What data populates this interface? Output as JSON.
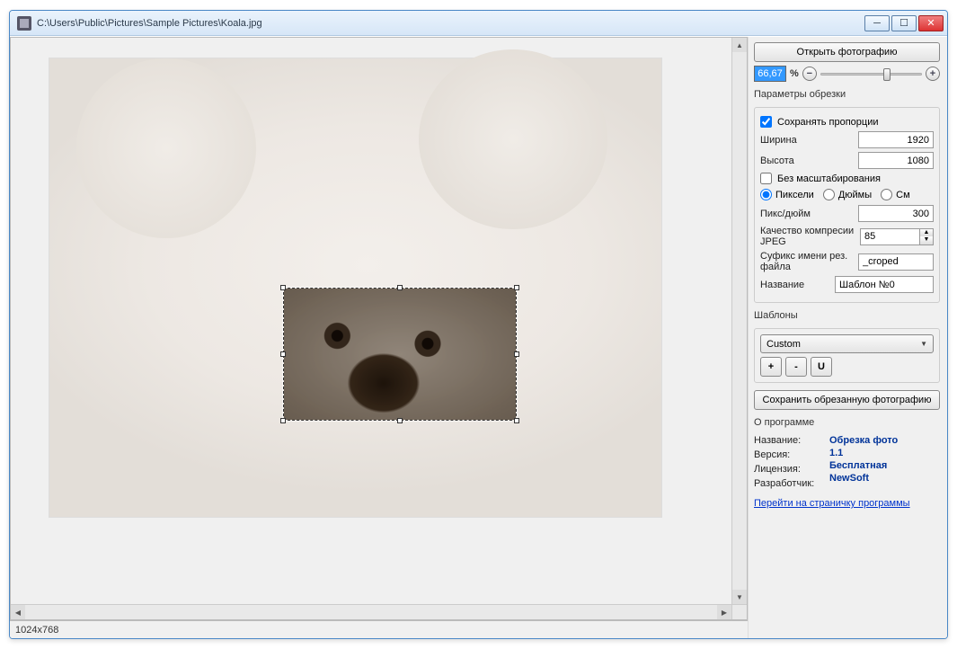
{
  "window": {
    "title": "C:\\Users\\Public\\Pictures\\Sample Pictures\\Koala.jpg"
  },
  "sidebar": {
    "open_button": "Открыть фотографию",
    "zoom_value": "66,67",
    "zoom_pct": "%",
    "zoom_out": "−",
    "zoom_in": "+",
    "crop": {
      "title": "Параметры обрезки",
      "keep_ratio": "Сохранять пропорции",
      "width_label": "Ширина",
      "width_value": "1920",
      "height_label": "Высота",
      "height_value": "1080",
      "no_scale": "Без масштабирования",
      "unit_px": "Пиксели",
      "unit_in": "Дюймы",
      "unit_cm": "См",
      "dpi_label": "Пикс/дюйм",
      "dpi_value": "300",
      "jpeg_label": "Качество компресии JPEG",
      "jpeg_value": "85",
      "suffix_label": "Суфикс имени рез. файла",
      "suffix_value": "_croped",
      "name_label": "Название",
      "name_value": "Шаблон №0"
    },
    "templates": {
      "title": "Шаблоны",
      "selected": "Custom",
      "add": "+",
      "remove": "-",
      "update": "U"
    },
    "save_button": "Сохранить обрезанную фотографию",
    "about": {
      "title": "О программе",
      "name_label": "Название:",
      "name_value": "Обрезка фото",
      "ver_label": "Версия:",
      "ver_value": "1.1",
      "lic_label": "Лицензия:",
      "lic_value": "Бесплатная",
      "dev_label": "Разработчик:",
      "dev_value": "NewSoft",
      "link": "Перейти на страничку программы"
    }
  },
  "status": {
    "dimensions": "1024x768"
  }
}
